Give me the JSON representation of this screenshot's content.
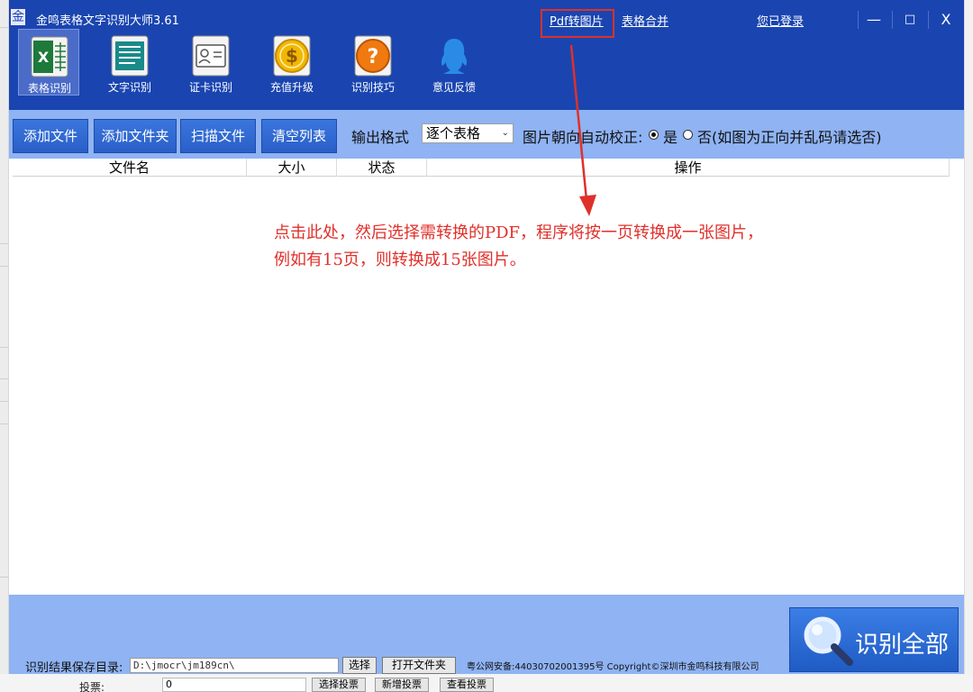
{
  "app": {
    "logo_char": "金",
    "title": "金鸣表格文字识别大师3.61"
  },
  "top_links": {
    "pdf_to_image": "Pdf转图片",
    "table_merge": "表格合并",
    "login": "您已登录"
  },
  "window_controls": {
    "minimize": "—",
    "maximize": "□",
    "close": "X"
  },
  "nav": {
    "items": [
      {
        "label": "表格识别",
        "icon": "excel-icon",
        "active": true
      },
      {
        "label": "文字识别",
        "icon": "document-icon",
        "active": false
      },
      {
        "label": "证卡识别",
        "icon": "id-card-icon",
        "active": false
      },
      {
        "label": "充值升级",
        "icon": "coin-icon",
        "active": false
      },
      {
        "label": "识别技巧",
        "icon": "help-icon",
        "active": false
      },
      {
        "label": "意见反馈",
        "icon": "qq-icon",
        "active": false
      }
    ]
  },
  "toolbar": {
    "add_file": "添加文件",
    "add_folder": "添加文件夹",
    "scan_file": "扫描文件",
    "clear_list": "清空列表",
    "output_format_label": "输出格式",
    "output_format_value": "逐个表格",
    "auto_correct_label": "图片朝向自动校正:",
    "option_yes": "是",
    "option_no": "否(如图为正向并乱码请选否)"
  },
  "table": {
    "columns": [
      "文件名",
      "大小",
      "状态",
      "操作"
    ]
  },
  "annotation": {
    "line1": "点击此处，然后选择需转换的PDF，程序将按一页转换成一张图片，",
    "line2": "例如有15页，则转换成15张图片。",
    "color": "#e0302a"
  },
  "footer": {
    "save_dir_label": "识别结果保存目录:",
    "save_dir_value": "D:\\jmocr\\jm189cn\\",
    "select_button": "选择",
    "open_folder_button": "打开文件夹",
    "copyright": "粤公网安备:44030702001395号 Copyright©深圳市金鸣科技有限公司",
    "recognize_all": "识别全部"
  },
  "background": {
    "bottom_label": "投票:",
    "bottom_field": "0",
    "buttons": [
      "选择投票",
      "新增投票",
      "查看投票"
    ]
  },
  "colors": {
    "titlebar": "#1a45b0",
    "toolbar": "#8fb3f3",
    "button": "#2a5fc8"
  }
}
